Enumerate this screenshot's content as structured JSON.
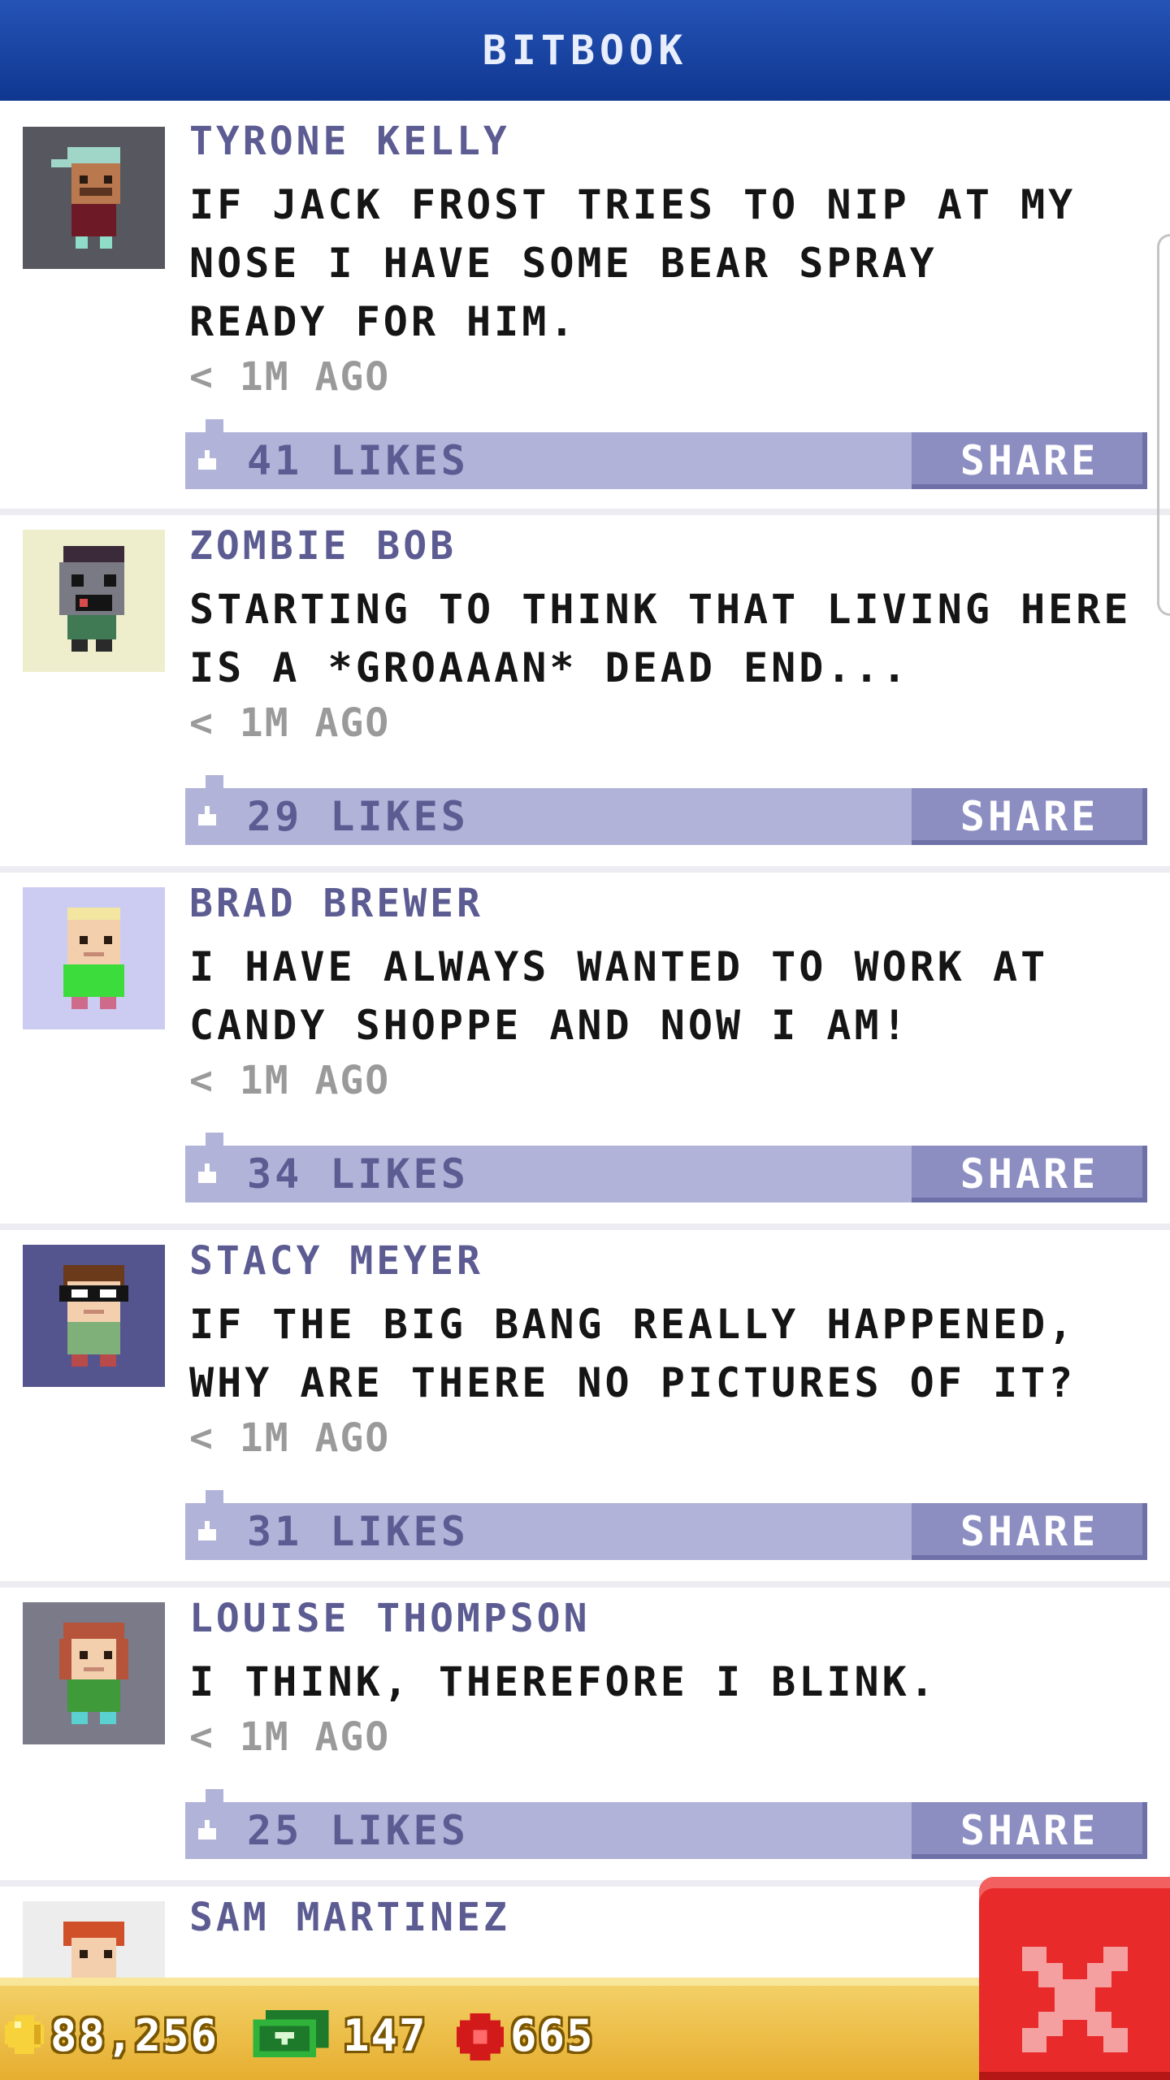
{
  "header": {
    "title": "BITBOOK"
  },
  "posts": [
    {
      "name": "TYRONE KELLY",
      "lines": [
        "IF JACK FROST TRIES TO NIP AT MY",
        "NOSE I HAVE SOME BEAR SPRAY",
        "READY FOR HIM."
      ],
      "time": "< 1M AGO",
      "likes": "41 LIKES",
      "share": "SHARE",
      "avatar_bg": "#575760"
    },
    {
      "name": "ZOMBIE BOB",
      "lines": [
        "STARTING TO THINK THAT LIVING HERE",
        "IS A *GROAAAN* DEAD END..."
      ],
      "time": "< 1M AGO",
      "likes": "29 LIKES",
      "share": "SHARE",
      "avatar_bg": "#eeeecc"
    },
    {
      "name": "BRAD BREWER",
      "lines": [
        "I HAVE ALWAYS WANTED TO WORK AT",
        "CANDY SHOPPE AND NOW I AM!"
      ],
      "time": "< 1M AGO",
      "likes": "34 LIKES",
      "share": "SHARE",
      "avatar_bg": "#ccccf2"
    },
    {
      "name": "STACY MEYER",
      "lines": [
        "IF THE BIG BANG REALLY HAPPENED,",
        "WHY ARE THERE NO PICTURES OF IT?"
      ],
      "time": "< 1M AGO",
      "likes": "31 LIKES",
      "share": "SHARE",
      "avatar_bg": "#54548e"
    },
    {
      "name": "LOUISE THOMPSON",
      "lines": [
        "I THINK, THEREFORE I BLINK."
      ],
      "time": "< 1M AGO",
      "likes": "25 LIKES",
      "share": "SHARE",
      "avatar_bg": "#7a7a88"
    },
    {
      "name": "SAM MARTINEZ",
      "lines": [],
      "time": "",
      "likes": "",
      "share": "",
      "avatar_bg": "#ededee"
    }
  ],
  "resources": {
    "coins": "88,256",
    "bux": "147",
    "hearts": "665"
  },
  "colors": {
    "header": "#1a47a8",
    "accent": "#5c5c93",
    "bar": "#b1b3d8",
    "share": "#8c8ec2",
    "close": "#e82a2a",
    "bottom": "#eab83d"
  },
  "icons": {
    "coin": "coin-icon",
    "cash": "cash-icon",
    "heart": "heart-icon",
    "close": "close-x-icon",
    "like": "like-icon"
  }
}
